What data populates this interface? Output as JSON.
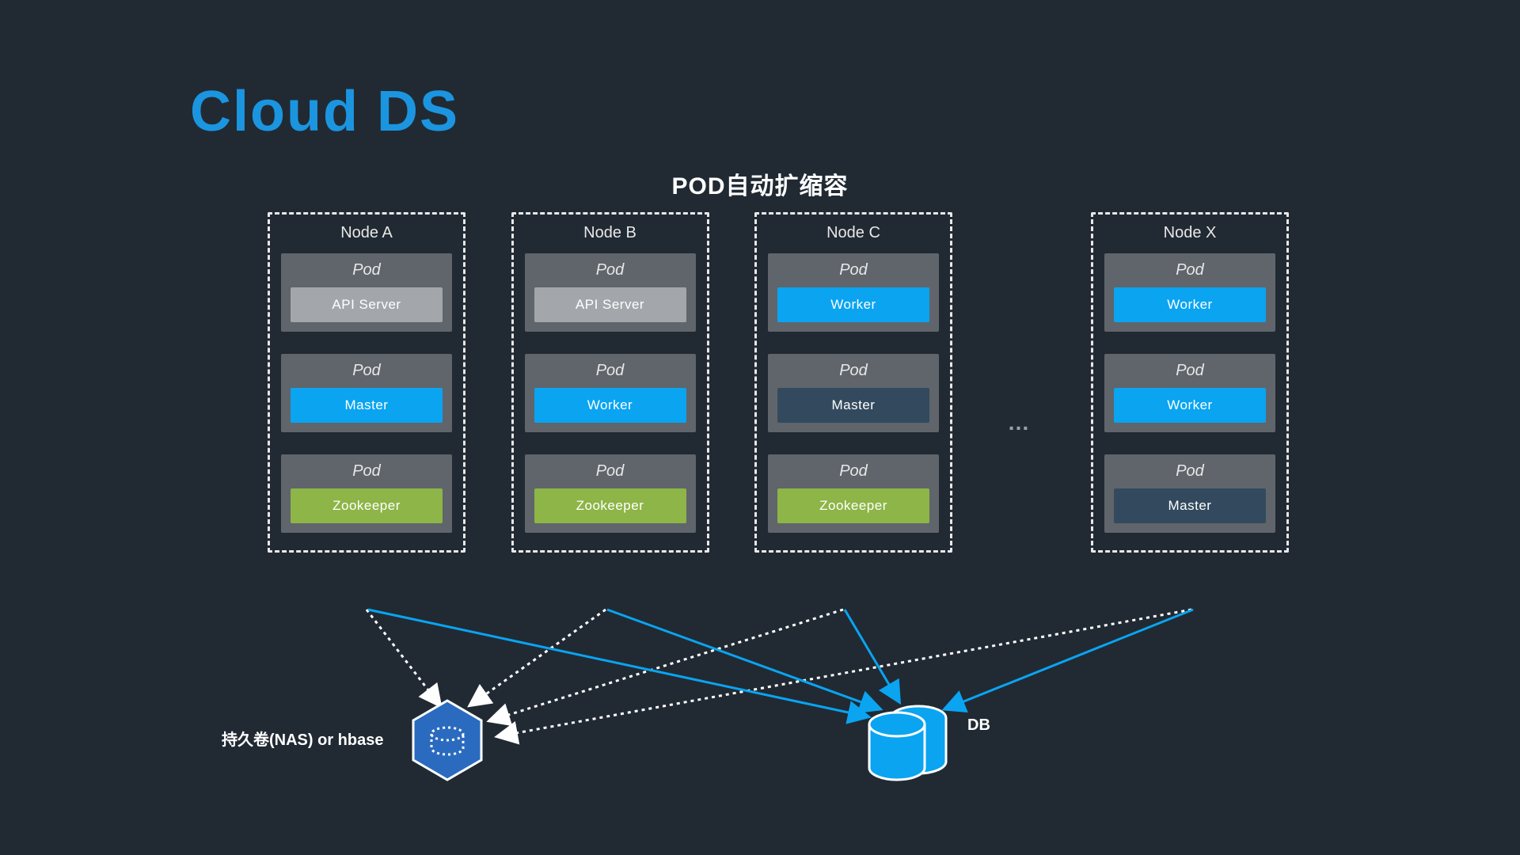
{
  "title": "Cloud DS",
  "subtitle": "POD自动扩缩容",
  "ellipsis": "…",
  "nas_label": "持久卷(NAS) or hbase",
  "db_label": "DB",
  "nodes": {
    "a": {
      "title": "Node A",
      "pod1": {
        "title": "Pod",
        "svc": "API Server",
        "cls": "svc-gray"
      },
      "pod2": {
        "title": "Pod",
        "svc": "Master",
        "cls": "svc-blue"
      },
      "pod3": {
        "title": "Pod",
        "svc": "Zookeeper",
        "cls": "svc-olive"
      }
    },
    "b": {
      "title": "Node B",
      "pod1": {
        "title": "Pod",
        "svc": "API Server",
        "cls": "svc-gray"
      },
      "pod2": {
        "title": "Pod",
        "svc": "Worker",
        "cls": "svc-blue"
      },
      "pod3": {
        "title": "Pod",
        "svc": "Zookeeper",
        "cls": "svc-olive"
      }
    },
    "c": {
      "title": "Node C",
      "pod1": {
        "title": "Pod",
        "svc": "Worker",
        "cls": "svc-blue"
      },
      "pod2": {
        "title": "Pod",
        "svc": "Master",
        "cls": "svc-navy"
      },
      "pod3": {
        "title": "Pod",
        "svc": "Zookeeper",
        "cls": "svc-olive"
      }
    },
    "x": {
      "title": "Node X",
      "pod1": {
        "title": "Pod",
        "svc": "Worker",
        "cls": "svc-blue"
      },
      "pod2": {
        "title": "Pod",
        "svc": "Worker",
        "cls": "svc-blue"
      },
      "pod3": {
        "title": "Pod",
        "svc": "Master",
        "cls": "svc-navy"
      }
    }
  }
}
